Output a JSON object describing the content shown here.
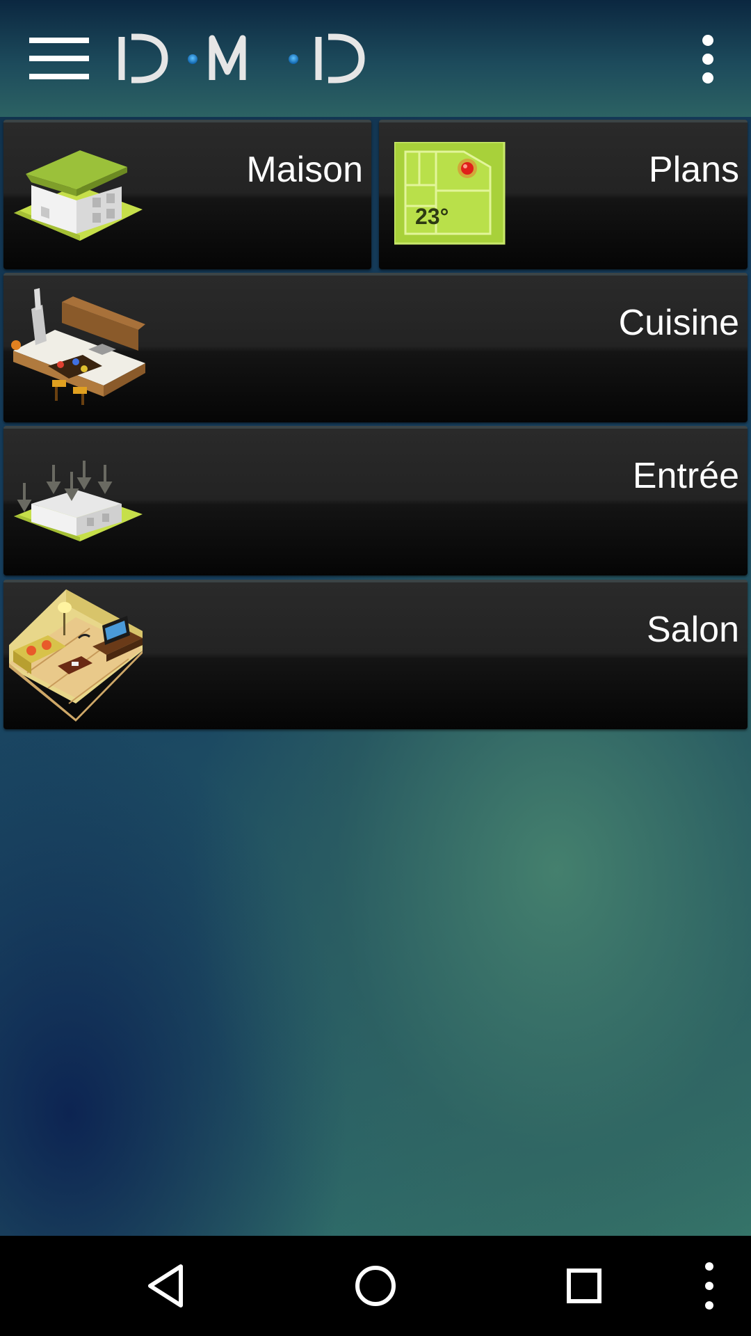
{
  "app": {
    "logo_text": "D·M·D",
    "menu_icon": "hamburger-menu-icon",
    "overflow_icon": "more-vert-icon"
  },
  "tiles": [
    {
      "label": "Maison",
      "icon": "house-icon"
    },
    {
      "label": "Plans",
      "icon": "floor-plan-icon",
      "plan_temperature": "23°"
    },
    {
      "label": "Cuisine",
      "icon": "kitchen-icon"
    },
    {
      "label": "Entrée",
      "icon": "entrance-icon"
    },
    {
      "label": "Salon",
      "icon": "living-room-icon"
    }
  ],
  "nav": {
    "back_icon": "back-triangle-icon",
    "home_icon": "home-circle-icon",
    "recents_icon": "recents-square-icon",
    "more_icon": "more-vert-icon"
  },
  "colors": {
    "tile_text": "#ffffff",
    "plan_green": "#a8d13a",
    "house_lawn": "#c6df4a",
    "accent_blue": "#1f8ee0"
  }
}
